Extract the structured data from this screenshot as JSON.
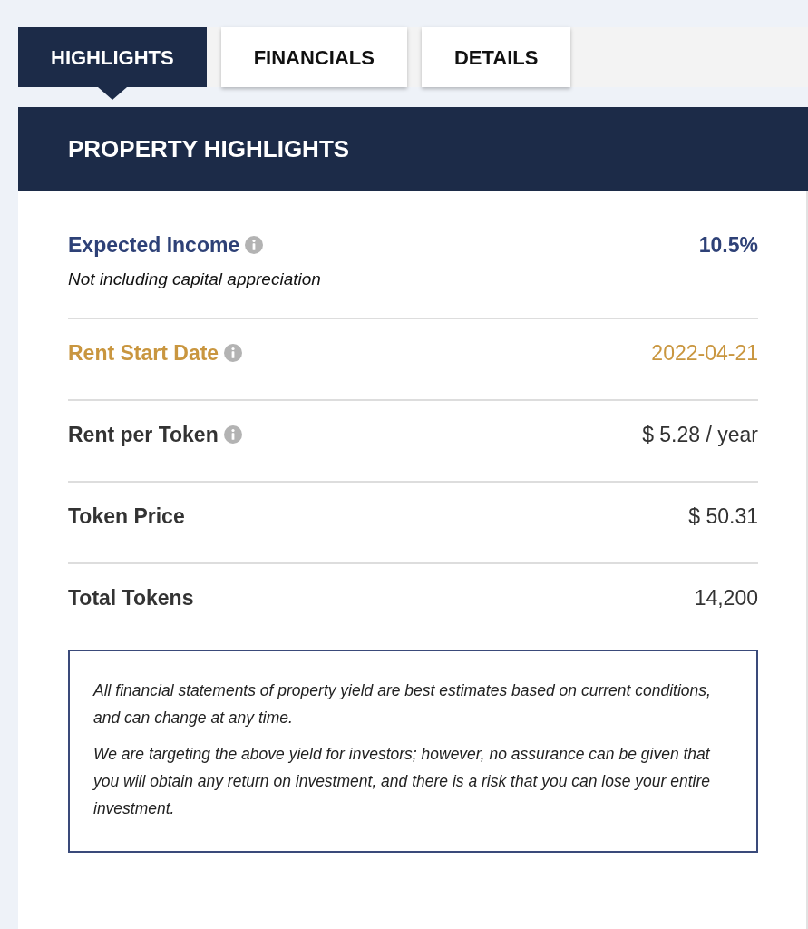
{
  "tabs": [
    {
      "label": "HIGHLIGHTS",
      "selected": true
    },
    {
      "label": "FINANCIALS",
      "selected": false
    },
    {
      "label": "DETAILS",
      "selected": false
    }
  ],
  "panel": {
    "title": "PROPERTY HIGHLIGHTS",
    "rows": [
      {
        "label": "Expected Income",
        "info": true,
        "note": "Not including capital appreciation",
        "value": "10.5%",
        "color": "#2e4177"
      },
      {
        "label": "Rent Start Date",
        "info": true,
        "value": "2022-04-21",
        "color": "#c9963f"
      },
      {
        "label": "Rent per Token",
        "info": true,
        "value": "$ 5.28 / year",
        "color": "#333333"
      },
      {
        "label": "Token Price",
        "info": false,
        "value": "$ 50.31",
        "color": "#333333"
      },
      {
        "label": "Total Tokens",
        "info": false,
        "value": "14,200",
        "color": "#333333"
      }
    ],
    "disclaimer": [
      "All financial statements of property yield are best estimates based on current conditions, and can change at any time.",
      "We are targeting the above yield for investors; however, no assurance can be given that you will obtain any return on investment, and there is a risk that you can lose your entire investment."
    ]
  }
}
